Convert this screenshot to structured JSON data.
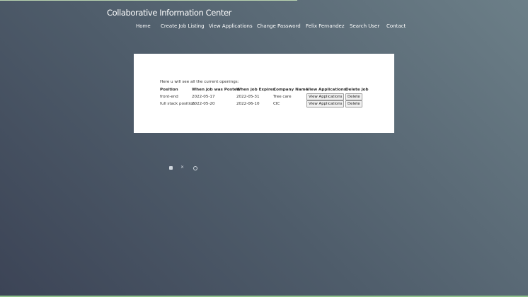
{
  "site": {
    "title": "Collaborative Information Center"
  },
  "nav": {
    "home": "Home",
    "create": "Create Job Listing",
    "view": "View Applications",
    "password": "Change Password",
    "user": "Felix Fernandez",
    "search": "Search User",
    "contact": "Contact"
  },
  "content": {
    "intro": "Here u will see all the current openings:",
    "headers": {
      "position": "Position",
      "posted": "When job was Posted",
      "expires": "When job Expires",
      "company": "Company Name",
      "view": "View Applications",
      "delete": "Delete Job"
    },
    "rows": [
      {
        "position": "front-end",
        "posted": "2022-05-17",
        "expires": "2022-05-31",
        "company": "Tree care",
        "view_label": "View Applications",
        "delete_label": "Delete"
      },
      {
        "position": "full stack position",
        "posted": "2022-05-20",
        "expires": "2022-06-10",
        "company": "CIC",
        "view_label": "View Applications",
        "delete_label": "Delete"
      }
    ]
  },
  "footer": {
    "icons": [
      "facebook-icon",
      "twitter-icon",
      "instagram-icon"
    ]
  },
  "colors": {
    "panel": "#ffffff",
    "text": "#2e2e2e",
    "accent": "#8fc48c"
  }
}
